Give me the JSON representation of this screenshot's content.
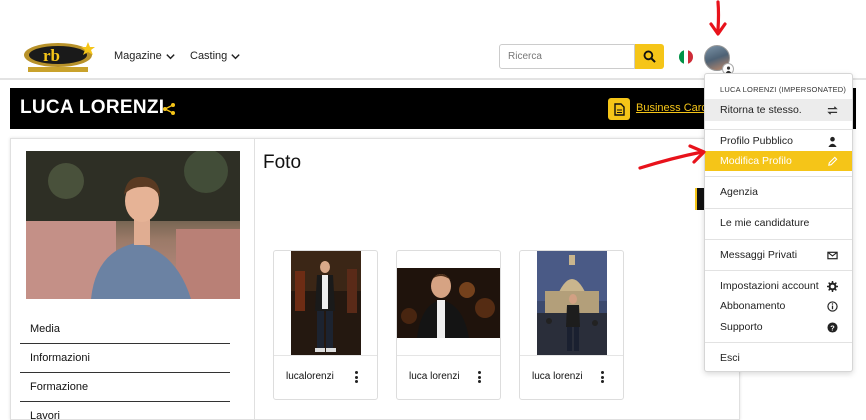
{
  "nav": {
    "magazine_label": "Magazine",
    "casting_label": "Casting",
    "search_placeholder": "Ricerca"
  },
  "profile": {
    "name": "LUCA LORENZI",
    "business_card_label": "Business Card"
  },
  "sidebar": {
    "items": [
      {
        "label": "Media"
      },
      {
        "label": "Informazioni"
      },
      {
        "label": "Formazione"
      },
      {
        "label": "Lavori"
      }
    ]
  },
  "photos": {
    "title": "Foto",
    "cards": [
      {
        "label": "lucalorenzi"
      },
      {
        "label": "luca lorenzi"
      },
      {
        "label": "luca lorenzi"
      }
    ]
  },
  "menu": {
    "header": "LUCA LORENZI (IMPERSONATED)",
    "items": [
      {
        "label": "Ritorna te stesso.",
        "icon": "swap-icon"
      },
      {
        "label": "Profilo Pubblico",
        "icon": "user-icon"
      },
      {
        "label": "Modifica Profilo",
        "icon": "pencil-icon"
      },
      {
        "label": "Agenzia",
        "icon": ""
      },
      {
        "label": "Le mie candidature",
        "icon": ""
      },
      {
        "label": "Messaggi Privati",
        "icon": "envelope-icon"
      },
      {
        "label": "Impostazioni account",
        "icon": "gear-icon"
      },
      {
        "label": "Abbonamento",
        "icon": "info-icon"
      },
      {
        "label": "Supporto",
        "icon": "help-icon"
      },
      {
        "label": "Esci",
        "icon": ""
      }
    ]
  },
  "colors": {
    "accent": "#f5c518",
    "annotation": "#e8121b"
  }
}
